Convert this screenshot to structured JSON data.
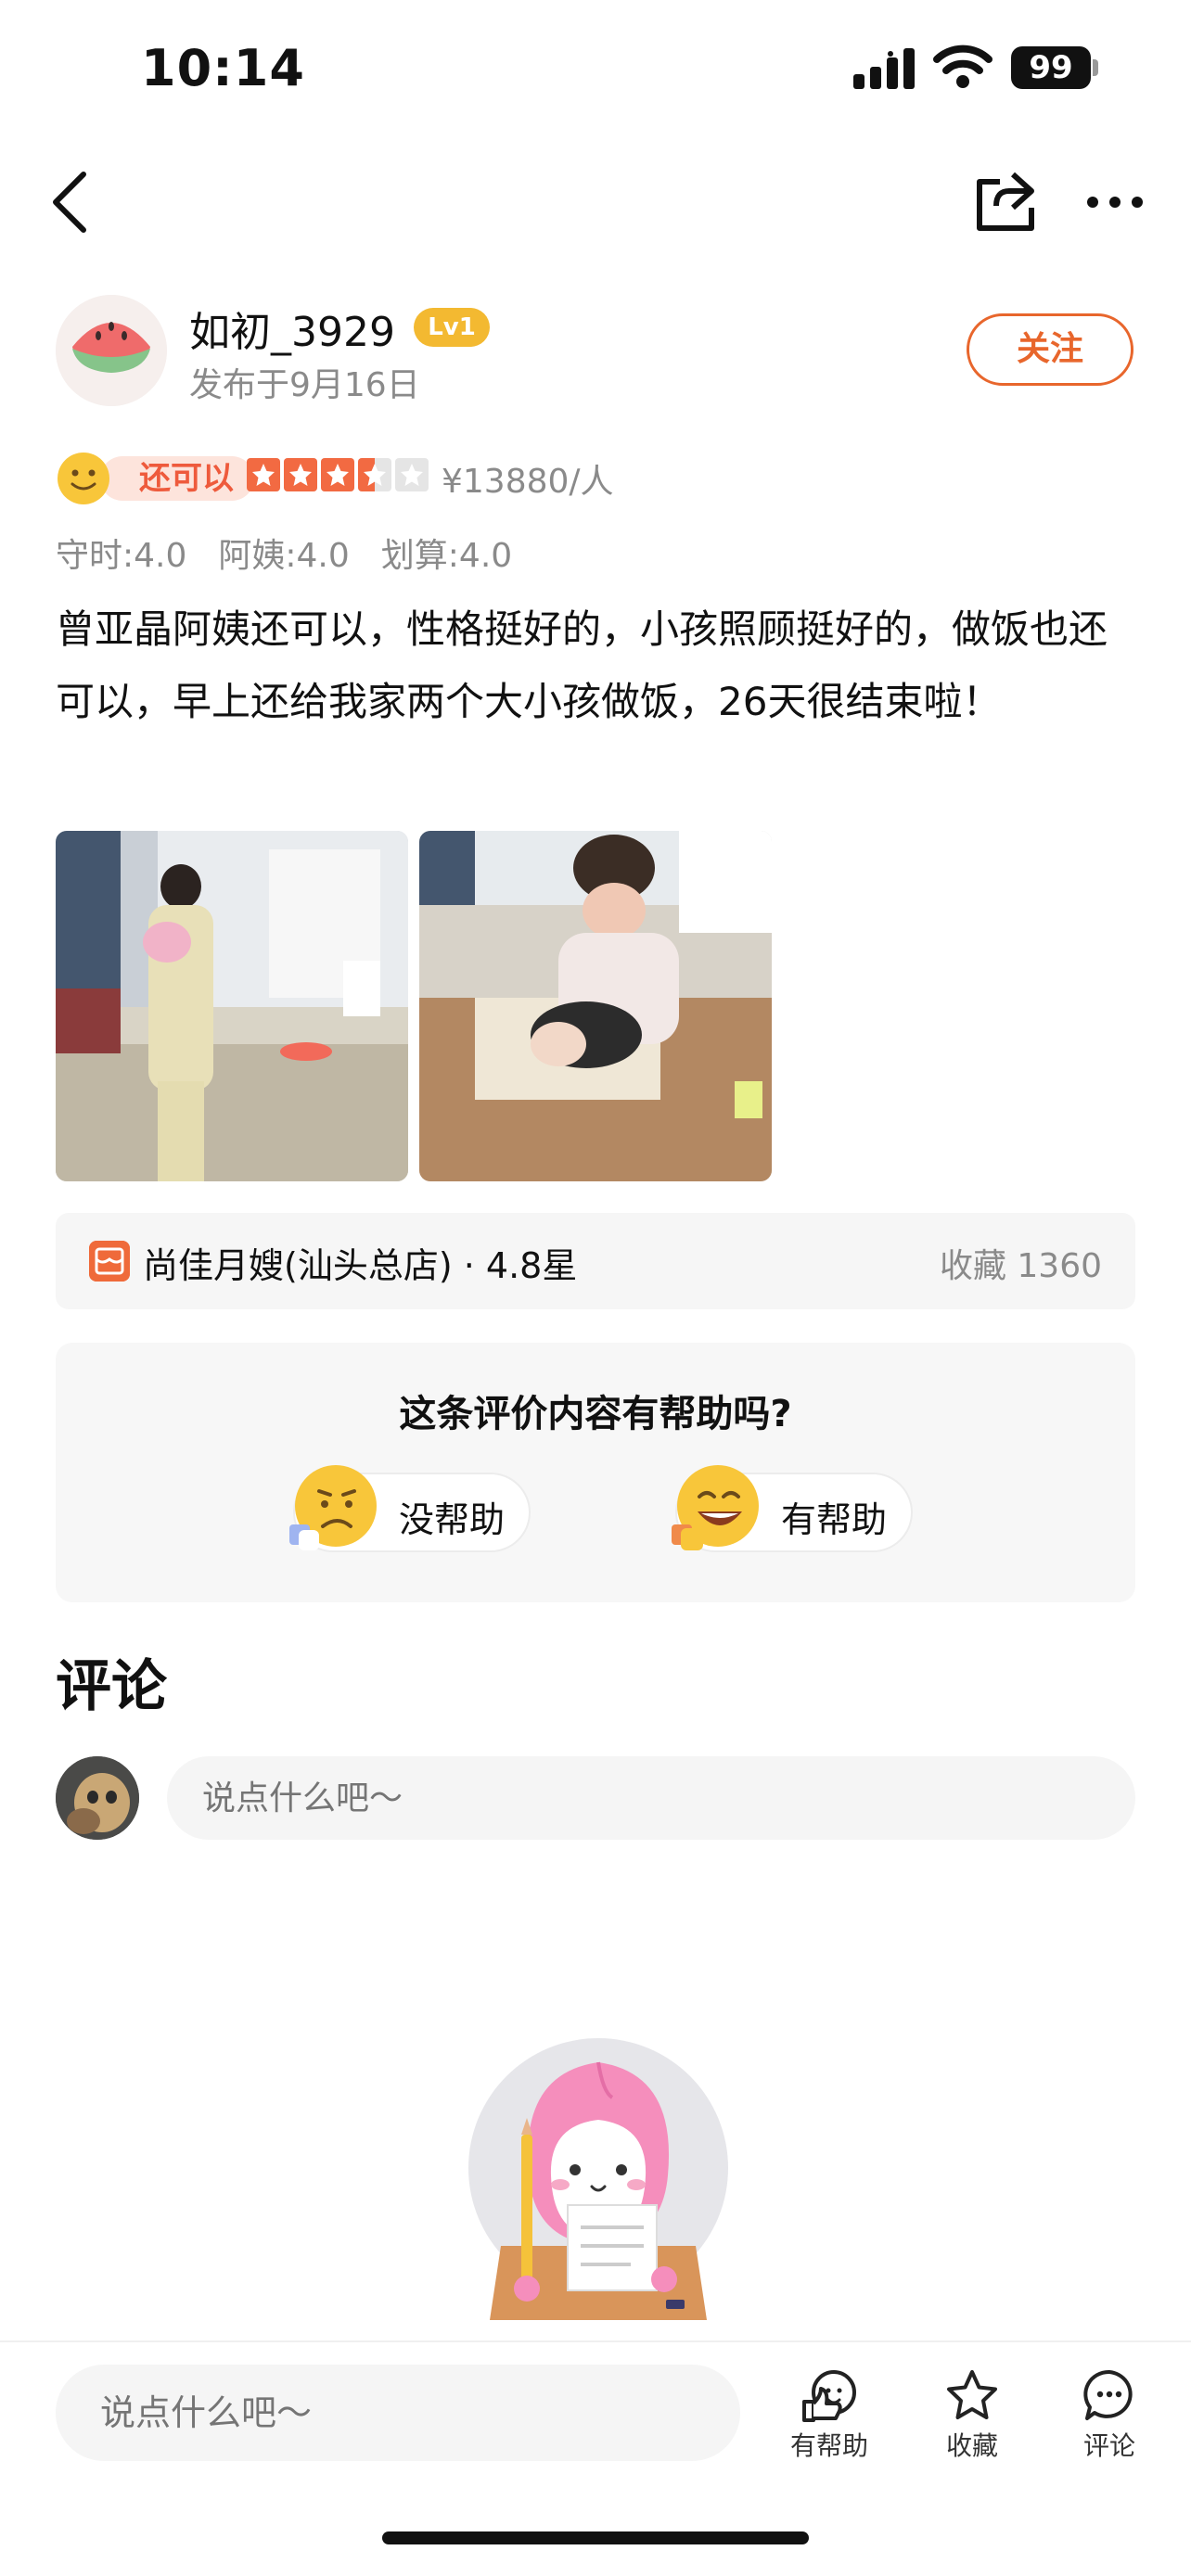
{
  "status_bar": {
    "time": "10:14",
    "battery": "99"
  },
  "author": {
    "name": "如初_3929",
    "level": "Lv1",
    "publish_date": "发布于9月16日",
    "follow_label": "关注"
  },
  "rating": {
    "tag": "还可以",
    "stars": 3.5,
    "max_stars": 5,
    "price": "¥13880/人",
    "sub_scores": [
      "守时:4.0",
      "阿姨:4.0",
      "划算:4.0"
    ]
  },
  "review": {
    "text": "曾亚晶阿姨还可以，性格挺好的，小孩照顾挺好的，做饭也还可以，早上还给我家两个大小孩做饭，26天很结束啦！"
  },
  "shop": {
    "name": "尚佳月嫂(汕头总店) · 4.8星",
    "favorites": "收藏 1360"
  },
  "helpful": {
    "question": "这条评价内容有帮助吗?",
    "no_label": "没帮助",
    "yes_label": "有帮助"
  },
  "comments": {
    "title": "评论",
    "placeholder": "说点什么吧～"
  },
  "bottom_bar": {
    "placeholder": "说点什么吧～",
    "helpful_label": "有帮助",
    "favorite_label": "收藏",
    "comment_label": "评论"
  },
  "colors": {
    "accent": "#e8662c",
    "tag_bg": "#fde4dc",
    "level": "#f3b931"
  }
}
